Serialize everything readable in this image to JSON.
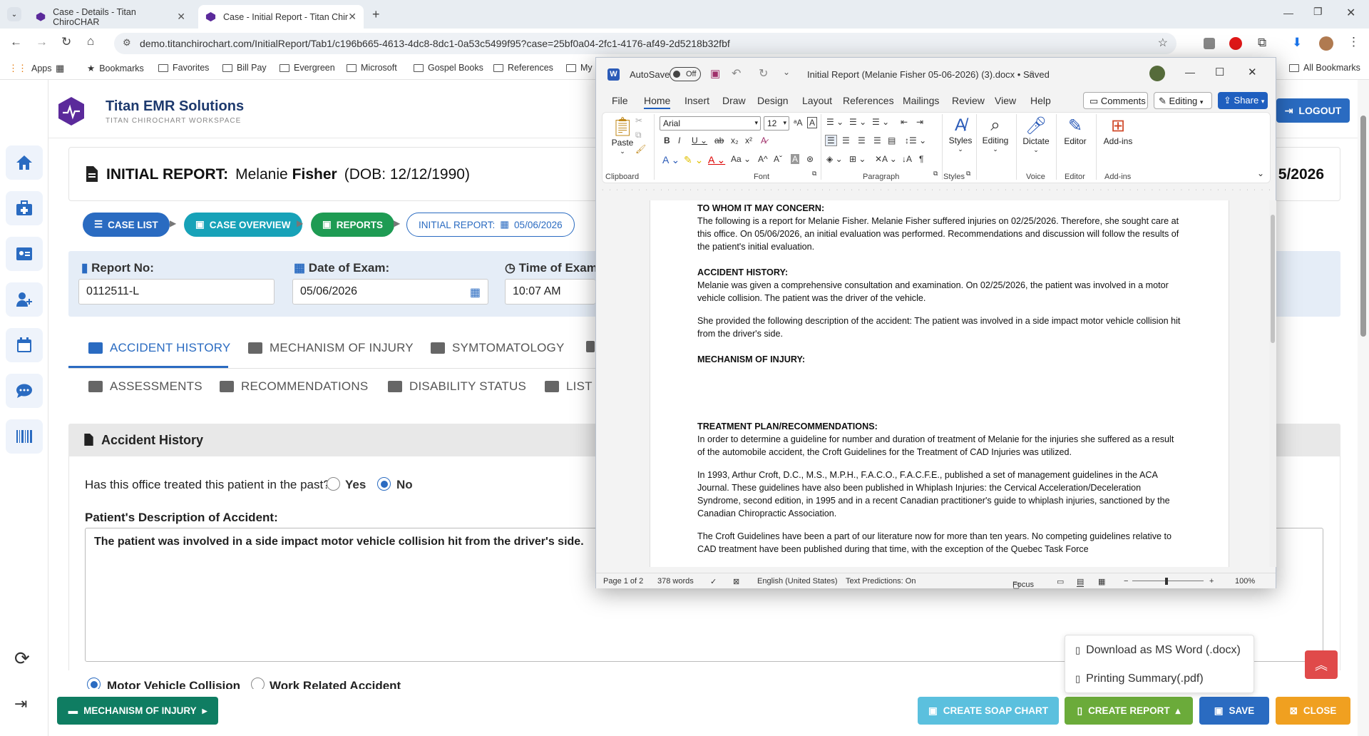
{
  "browser": {
    "tabs": [
      {
        "title": "Case - Details - Titan ChiroCHAR",
        "active": false
      },
      {
        "title": "Case - Initial Report - Titan Chir",
        "active": true
      }
    ],
    "url": "demo.titanchirochart.com/InitialReport/Tab1/c196b665-4613-4dc8-8dc1-0a53c5499f95?case=25bf0a04-2fc1-4176-af49-2d5218b32fbf",
    "bookmarks": [
      "Apps",
      "Bookmarks",
      "Favorites",
      "Bill Pay",
      "Evergreen",
      "Microsoft",
      "Gospel Books",
      "References",
      "My"
    ],
    "all_bookmarks": "All Bookmarks"
  },
  "app": {
    "brand_title": "Titan EMR Solutions",
    "brand_sub": "TITAN CHIROCHART WORKSPACE",
    "logout": "LOGOUT",
    "report_label": "INITIAL REPORT:",
    "patient_first": "Melanie",
    "patient_last": "Fisher",
    "dob": "(DOB: 12/12/1990)",
    "date_right": "5/2026",
    "breadcrumbs": {
      "case_list": "CASE LIST",
      "case_overview": "CASE OVERVIEW",
      "reports": "REPORTS",
      "initial_report": "INITIAL REPORT:",
      "initial_report_date": "05/06/2026"
    },
    "fields": {
      "report_no_label": "Report No:",
      "report_no": "0112511-L",
      "date_label": "Date of Exam:",
      "date": "05/06/2026",
      "time_label": "Time of Exam:",
      "time": "10:07 AM"
    },
    "tabs_row1": [
      "ACCIDENT HISTORY",
      "MECHANISM OF INJURY",
      "SYMTOMATOLOGY"
    ],
    "tabs_row2": [
      "ASSESSMENTS",
      "RECOMMENDATIONS",
      "DISABILITY STATUS",
      "LIST O"
    ],
    "section_title": "Accident History",
    "question": "Has this office treated this patient in the past?",
    "yes": "Yes",
    "no": "No",
    "desc_label": "Patient's Description of Accident:",
    "desc_text": "The patient was involved in a side impact motor vehicle collision hit from the driver's side.",
    "radio_a": "Motor Vehicle Collision",
    "radio_b": "Work Related Accident",
    "footer": {
      "mechanism": "MECHANISM OF INJURY",
      "soap": "CREATE SOAP CHART",
      "create_report": "CREATE REPORT",
      "save": "SAVE",
      "close": "CLOSE"
    },
    "dropdown": [
      "Download as MS Word (.docx)",
      "Printing Summary(.pdf)"
    ],
    "colors": {
      "primary": "#2a6bc1",
      "teal": "#17a2b8",
      "green": "#1e9b53",
      "dark_green": "#0f7d62",
      "orange": "#f0a020",
      "red": "#e04a4a"
    }
  },
  "word": {
    "autosave": "AutoSave",
    "autosave_state": "Off",
    "title": "Initial Report (Melanie Fisher 05-06-2026) (3).docx • Saved",
    "menus": [
      "File",
      "Home",
      "Insert",
      "Draw",
      "Design",
      "Layout",
      "References",
      "Mailings",
      "Review",
      "View",
      "Help"
    ],
    "comments": "Comments",
    "editing": "Editing",
    "share": "Share",
    "font": "Arial",
    "size": "12",
    "groups": {
      "clipboard": "Clipboard",
      "font": "Font",
      "paragraph": "Paragraph",
      "styles": "Styles",
      "voice": "Voice",
      "editor": "Editor",
      "addins": "Add-ins"
    },
    "big_buttons": {
      "paste": "Paste",
      "styles": "Styles",
      "editing": "Editing",
      "dictate": "Dictate",
      "editor": "Editor",
      "addins": "Add-ins"
    },
    "doc": [
      {
        "h": true,
        "t": "TO WHOM IT MAY CONCERN:"
      },
      {
        "h": false,
        "t": "The following is a report for Melanie  Fisher. Melanie  Fisher suffered injuries on 02/25/2026. Therefore, she sought care at this office. On 05/06/2026, an initial evaluation was performed. Recommendations and discussion will follow the results of the patient's initial evaluation."
      },
      {
        "h": true,
        "t": "ACCIDENT HISTORY:"
      },
      {
        "h": false,
        "t": "Melanie  was given a comprehensive consultation and examination. On 02/25/2026, the patient was involved in a motor vehicle collision. The patient was the driver of the vehicle."
      },
      {
        "h": false,
        "t": "She provided the following description of the accident: The patient was involved in a side impact motor vehicle collision hit from the driver's side."
      },
      {
        "h": true,
        "t": "MECHANISM OF INJURY:"
      },
      {
        "h": true,
        "t": "TREATMENT PLAN/RECOMMENDATIONS:"
      },
      {
        "h": false,
        "t": "In order to determine a guideline for number and duration of treatment of Melanie  for the injuries she suffered as a result of the automobile accident, the Croft Guidelines for the Treatment of CAD Injuries was utilized."
      },
      {
        "h": false,
        "t": "In 1993, Arthur Croft, D.C., M.S., M.P.H., F.A.C.O., F.A.C.F.E., published a set of management guidelines in the ACA Journal. These guidelines have also been published in Whiplash Injuries: the Cervical Acceleration/Deceleration Syndrome, second edition, in 1995 and in a recent Canadian practitioner's guide to whiplash injuries, sanctioned by the Canadian Chiropractic Association."
      },
      {
        "h": false,
        "t": "The Croft Guidelines have been a part of our literature now for more than ten years. No competing guidelines relative to CAD treatment have been published during that time, with the exception of the Quebec Task Force"
      }
    ],
    "status": {
      "page": "Page 1 of 2",
      "words": "378 words",
      "lang": "English (United States)",
      "pred": "Text Predictions: On",
      "focus": "Focus",
      "zoom": "100%"
    }
  }
}
